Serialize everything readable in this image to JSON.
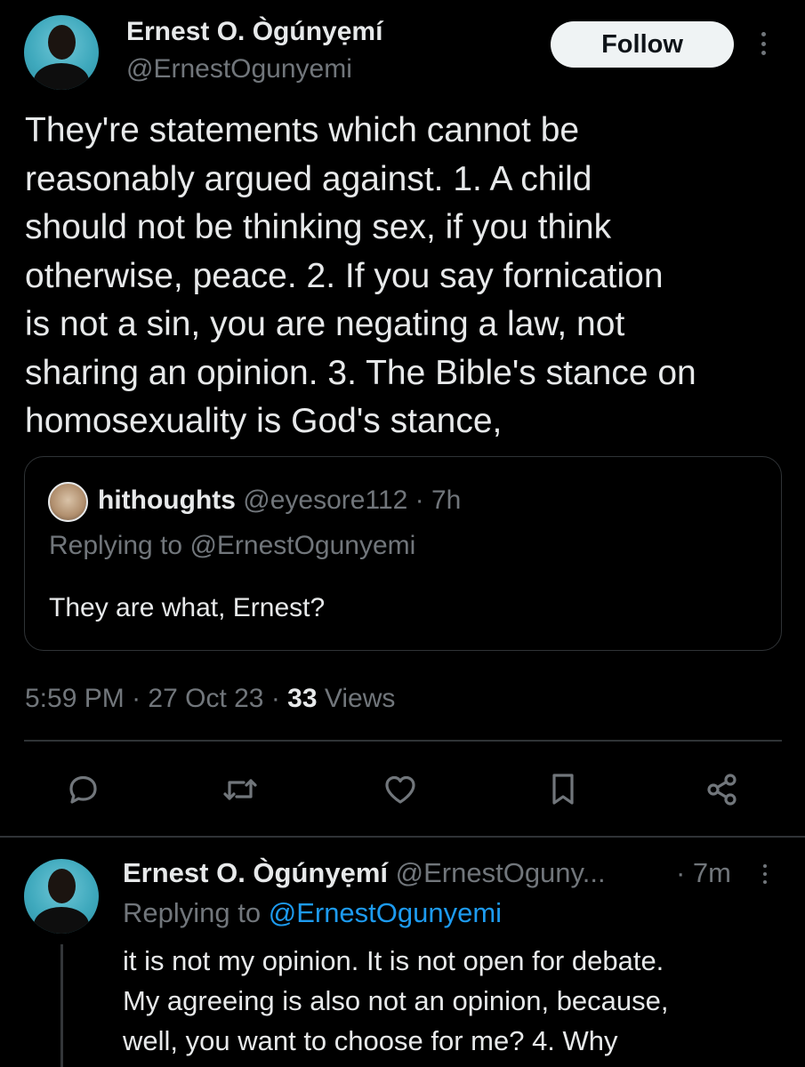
{
  "tweet": {
    "author_name": "Ernest O. Ògúnyẹmí",
    "author_handle": "@ErnestOgunyemi",
    "follow_label": "Follow",
    "text": "They're statements which cannot be\nreasonably argued against. 1. A child\nshould not be thinking sex, if you think\notherwise, peace. 2. If you say fornication\nis not a sin, you are negating a law, not\nsharing an opinion. 3. The Bible's stance on\nhomosexuality is God's stance,",
    "quote": {
      "name": "hithoughts",
      "handle": "@eyesore112",
      "time": "· 7h",
      "replying_prefix": "Replying to",
      "replying_to": "@ErnestOgunyemi",
      "text": "They are what, Ernest?"
    },
    "time": "5:59 PM",
    "date": "· 27 Oct 23 ·",
    "views_count": "33",
    "views_label": "Views"
  },
  "actions": {
    "reply": "reply-icon",
    "retweet": "retweet-icon",
    "like": "heart-icon",
    "bookmark": "bookmark-icon",
    "share": "share-icon"
  },
  "reply": {
    "author_name": "Ernest O. Ògúnyẹmí",
    "author_handle": "@ErnestOguny...",
    "time": "· 7m",
    "replying_prefix": "Replying to",
    "replying_to": "@ErnestOgunyemi",
    "text": "it is not my opinion. It is not open for debate.\nMy agreeing is also not an opinion, because,\nwell, you want to choose for me? 4. Why"
  },
  "colors": {
    "background": "#000000",
    "text": "#e7e9ea",
    "secondary": "#71767b",
    "border": "#2f3336",
    "link": "#1d9bf0"
  }
}
